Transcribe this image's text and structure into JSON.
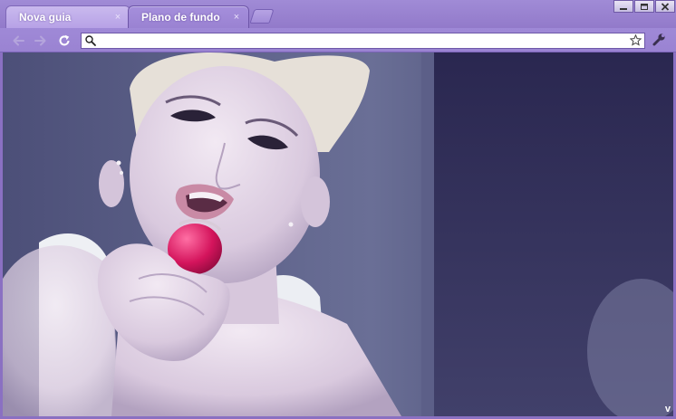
{
  "tabs": [
    {
      "title": "Nova guia",
      "close": "×",
      "active": false
    },
    {
      "title": "Plano de fundo",
      "close": "×",
      "active": true
    }
  ],
  "omnibox": {
    "value": "",
    "placeholder": ""
  },
  "icons": {
    "back": "back-arrow-icon",
    "forward": "forward-arrow-icon",
    "reload": "reload-icon",
    "search": "search-icon",
    "star": "star-icon",
    "wrench": "wrench-icon",
    "minimize": "minimize-icon",
    "maximize": "maximize-icon",
    "close": "close-icon",
    "chevron": "chevron-down-icon"
  },
  "corner_indicator": "v",
  "colors": {
    "frame": "#9077c8",
    "tab_active": "#9a82d2",
    "tab_inactive": "#c9b9ee",
    "omnibox_bg": "#ffffff"
  }
}
